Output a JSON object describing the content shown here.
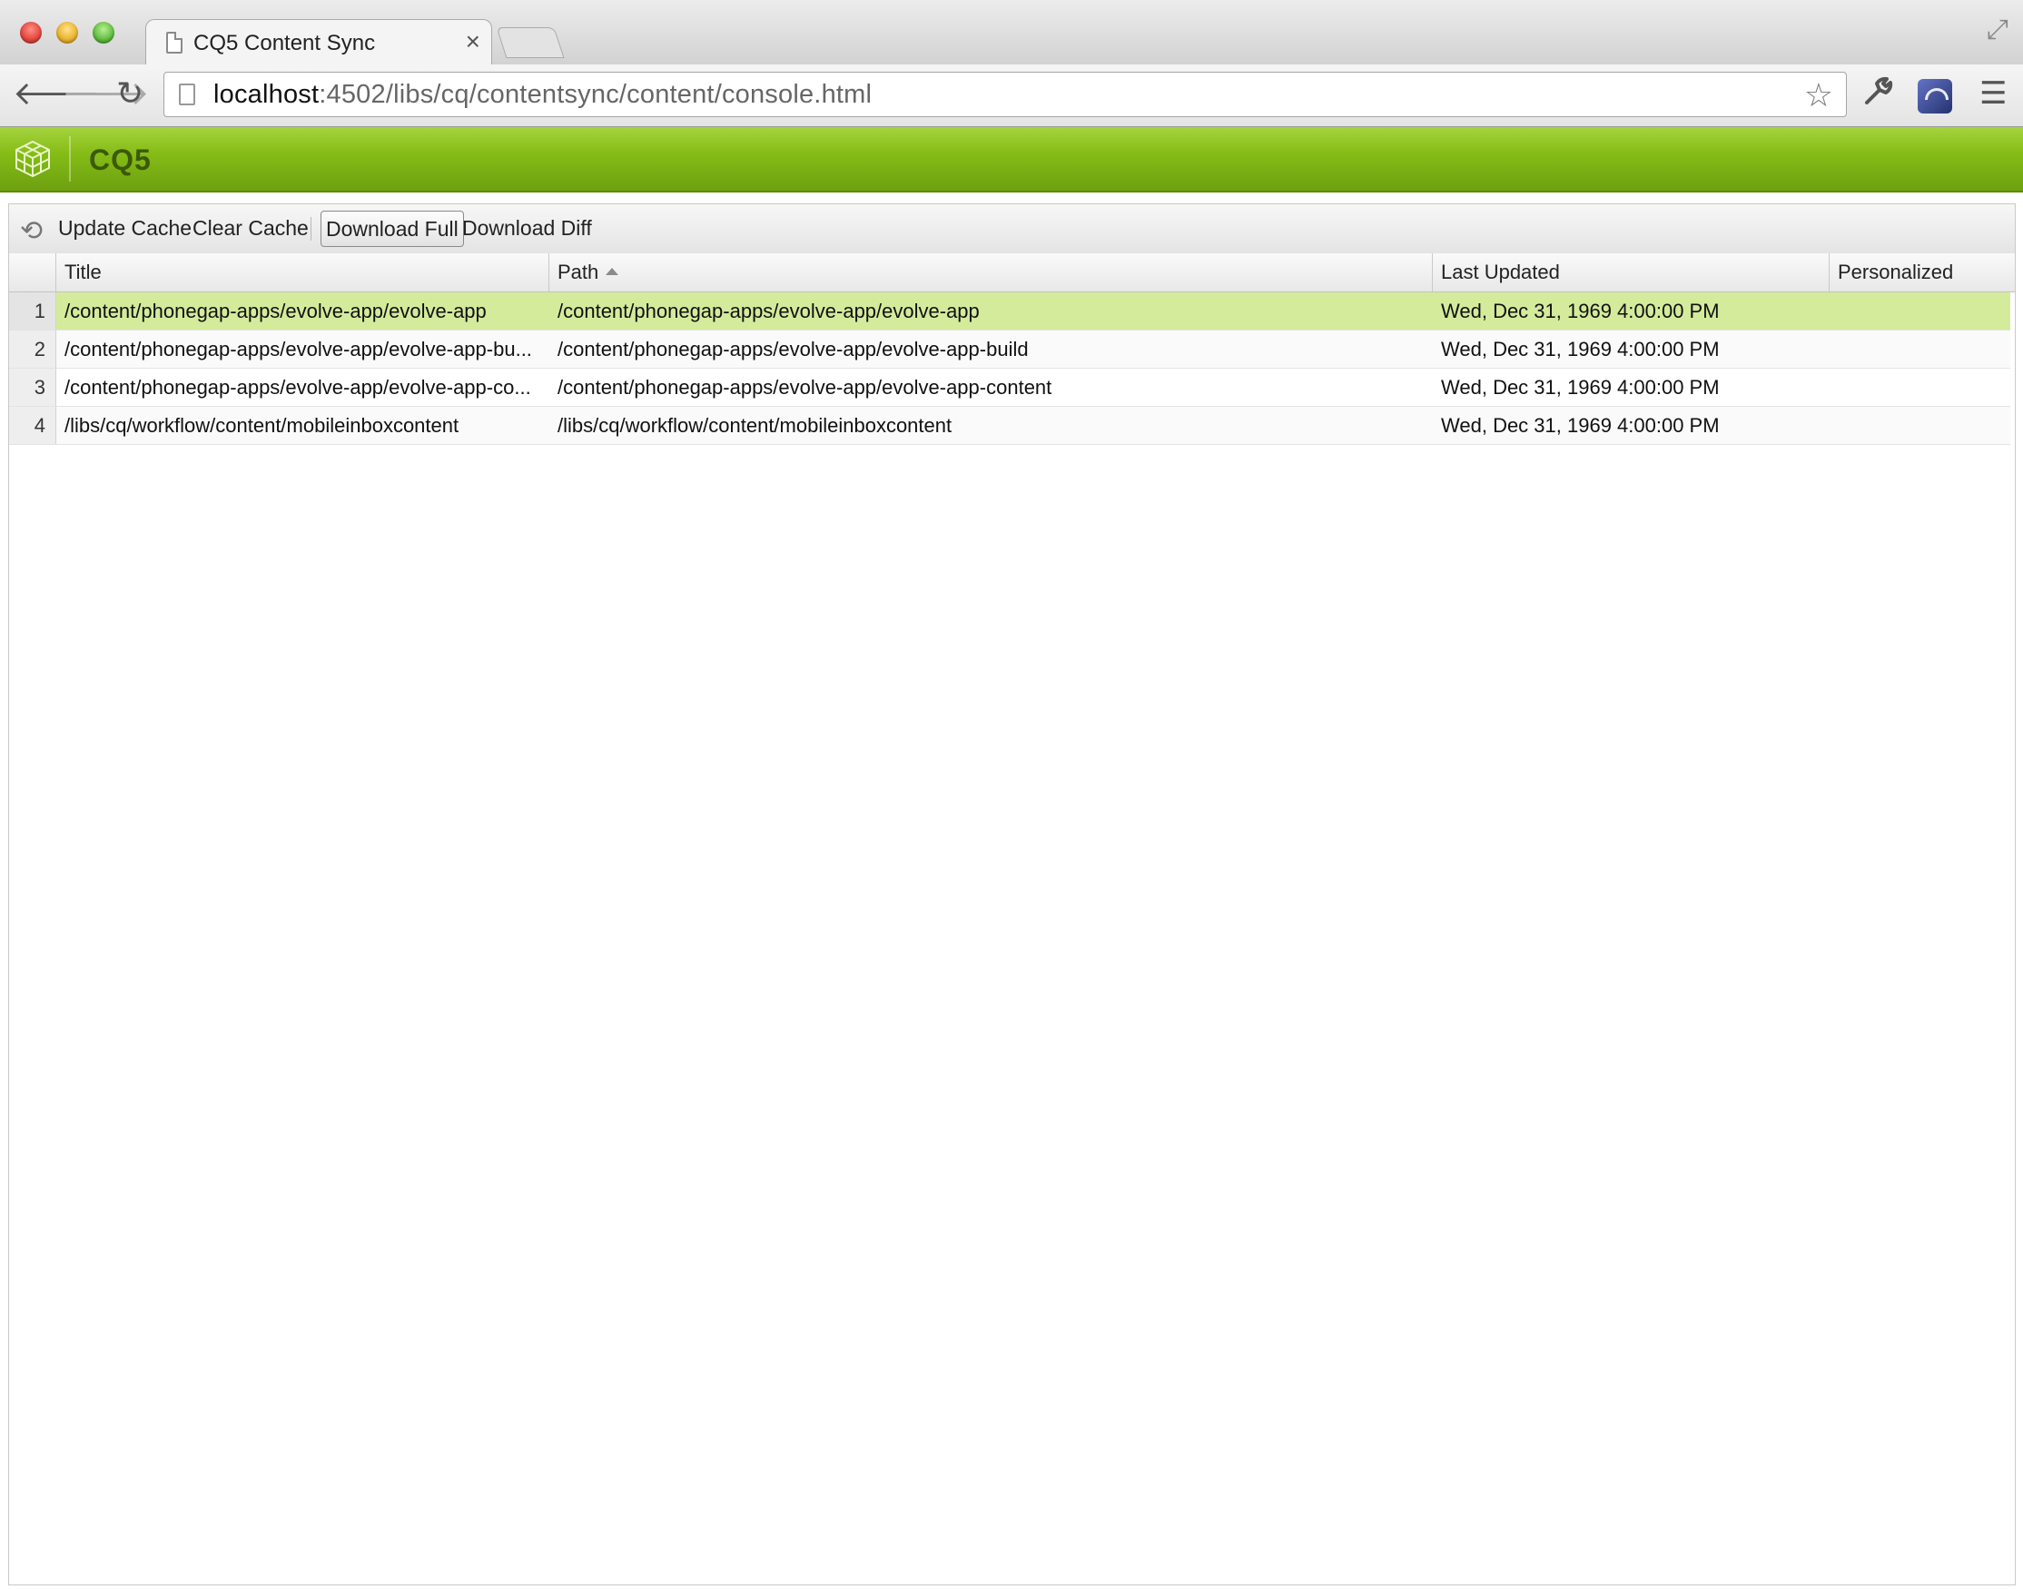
{
  "browser": {
    "tab_title": "CQ5 Content Sync",
    "tab_close": "×",
    "url_host": "localhost",
    "url_rest": ":4502/libs/cq/contentsync/content/console.html"
  },
  "app": {
    "title": "CQ5",
    "brand_color": "#86bd17"
  },
  "toolbar": {
    "update_cache": "Update Cache",
    "clear_cache": "Clear Cache",
    "download_full": "Download Full",
    "download_diff": "Download Diff"
  },
  "grid": {
    "columns": {
      "title": "Title",
      "path": "Path",
      "last_updated": "Last Updated",
      "personalized": "Personalized"
    },
    "sort_column": "Path",
    "sort_direction": "ascending",
    "rows": [
      {
        "num": "1",
        "title": "/content/phonegap-apps/evolve-app/evolve-app",
        "path": "/content/phonegap-apps/evolve-app/evolve-app",
        "last_updated": "Wed, Dec 31, 1969 4:00:00 PM",
        "personalized": "",
        "selected": true
      },
      {
        "num": "2",
        "title": "/content/phonegap-apps/evolve-app/evolve-app-bu...",
        "path": "/content/phonegap-apps/evolve-app/evolve-app-build",
        "last_updated": "Wed, Dec 31, 1969 4:00:00 PM",
        "personalized": "",
        "selected": false
      },
      {
        "num": "3",
        "title": "/content/phonegap-apps/evolve-app/evolve-app-co...",
        "path": "/content/phonegap-apps/evolve-app/evolve-app-content",
        "last_updated": "Wed, Dec 31, 1969 4:00:00 PM",
        "personalized": "",
        "selected": false
      },
      {
        "num": "4",
        "title": "/libs/cq/workflow/content/mobileinboxcontent",
        "path": "/libs/cq/workflow/content/mobileinboxcontent",
        "last_updated": "Wed, Dec 31, 1969 4:00:00 PM",
        "personalized": "",
        "selected": false
      }
    ]
  }
}
